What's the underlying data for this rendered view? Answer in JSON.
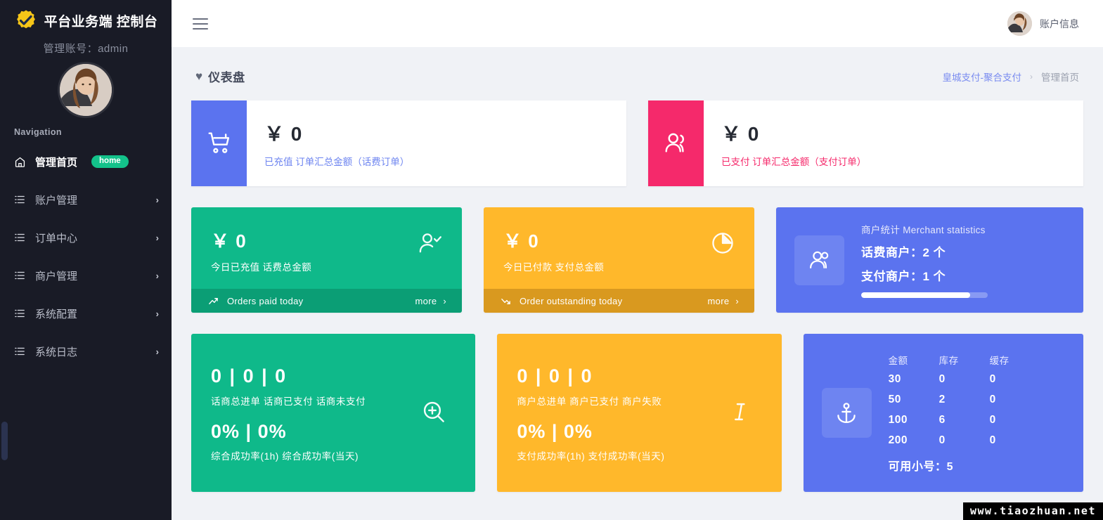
{
  "sidebar": {
    "brand_title": "平台业务端 控制台",
    "logo_icon": "gear-check-logo",
    "admin_line": "管理账号：admin",
    "avatar_icon": "user-avatar",
    "nav_label": "Navigation",
    "items": [
      {
        "label": "管理首页",
        "icon": "home-icon",
        "badge": "home",
        "arrow": "",
        "active": true
      },
      {
        "label": "账户管理",
        "icon": "list-icon",
        "badge": "",
        "arrow": "›",
        "active": false
      },
      {
        "label": "订单中心",
        "icon": "list-icon",
        "badge": "",
        "arrow": "›",
        "active": false
      },
      {
        "label": "商户管理",
        "icon": "list-icon",
        "badge": "",
        "arrow": "›",
        "active": false
      },
      {
        "label": "系统配置",
        "icon": "list-icon",
        "badge": "",
        "arrow": "›",
        "active": false
      },
      {
        "label": "系统日志",
        "icon": "list-icon",
        "badge": "",
        "arrow": "›",
        "active": false
      }
    ]
  },
  "topbar": {
    "menu_icon": "hamburger-icon",
    "account_label": "账户信息",
    "account_avatar_icon": "user-avatar"
  },
  "page": {
    "heart_icon": "♥",
    "title": "仪表盘",
    "breadcrumb": {
      "link": "皇城支付-聚合支付",
      "separator": "›",
      "current": "管理首页"
    }
  },
  "cards": {
    "top": [
      {
        "icon": "shopping-cart-icon",
        "icon_bg": "#5b73ef",
        "value": "￥ 0",
        "sub": "已充值 订单汇总金额（话费订单）",
        "sub_color": "#6d84f0"
      },
      {
        "icon": "users-icon",
        "icon_bg": "#f5296b",
        "value": "￥ 0",
        "sub": "已支付 订单汇总金额（支付订单）",
        "sub_color": "#f5296b"
      }
    ],
    "mid": [
      {
        "bg": "#0fb98a",
        "foot_bg": "#0b9e75",
        "value": "￥ 0",
        "label": "今日已充值 话费总金额",
        "icon": "user-check-icon",
        "foot_icon": "trend-up-icon",
        "foot_text": "Orders paid today",
        "more_label": "more",
        "more_arrow": "›"
      },
      {
        "bg": "#ffb82b",
        "foot_bg": "#d9991f",
        "value": "￥ 0",
        "label": "今日已付款 支付总金额",
        "icon": "pie-chart-icon",
        "foot_icon": "trend-down-icon",
        "foot_text": "Order outstanding today",
        "more_label": "more",
        "more_arrow": "›"
      }
    ],
    "merchant": {
      "bg": "#5b73ef",
      "icon": "users-group-icon",
      "title": "商户统计 Merchant statistics",
      "stat1": "话费商户：2 个",
      "stat2": "支付商户：1 个",
      "progress_percent": 86
    },
    "bottom": [
      {
        "bg": "#0fb98a",
        "nums": "0 | 0 | 0",
        "caption": "话商总进单  话商已支付  话商未支付",
        "nums2": "0%  |  0%",
        "caption2": "综合成功率(1h)  综合成功率(当天)",
        "icon": "zoom-in-icon"
      },
      {
        "bg": "#ffb82b",
        "nums": "0 | 0 | 0",
        "caption": "商户总进单  商户已支付  商户失败",
        "nums2": "0%  |  0%",
        "caption2": "支付成功率(1h)  支付成功率(当天)",
        "icon": "text-cursor-icon"
      }
    ],
    "stock": {
      "bg": "#5b73ef",
      "icon": "anchor-icon",
      "headers": [
        "金额",
        "库存",
        "缓存"
      ],
      "rows": [
        [
          "30",
          "0",
          "0"
        ],
        [
          "50",
          "2",
          "0"
        ],
        [
          "100",
          "6",
          "0"
        ],
        [
          "200",
          "0",
          "0"
        ]
      ],
      "total_label": "可用小号：5"
    }
  },
  "watermark": "www.tiaozhuan.net"
}
